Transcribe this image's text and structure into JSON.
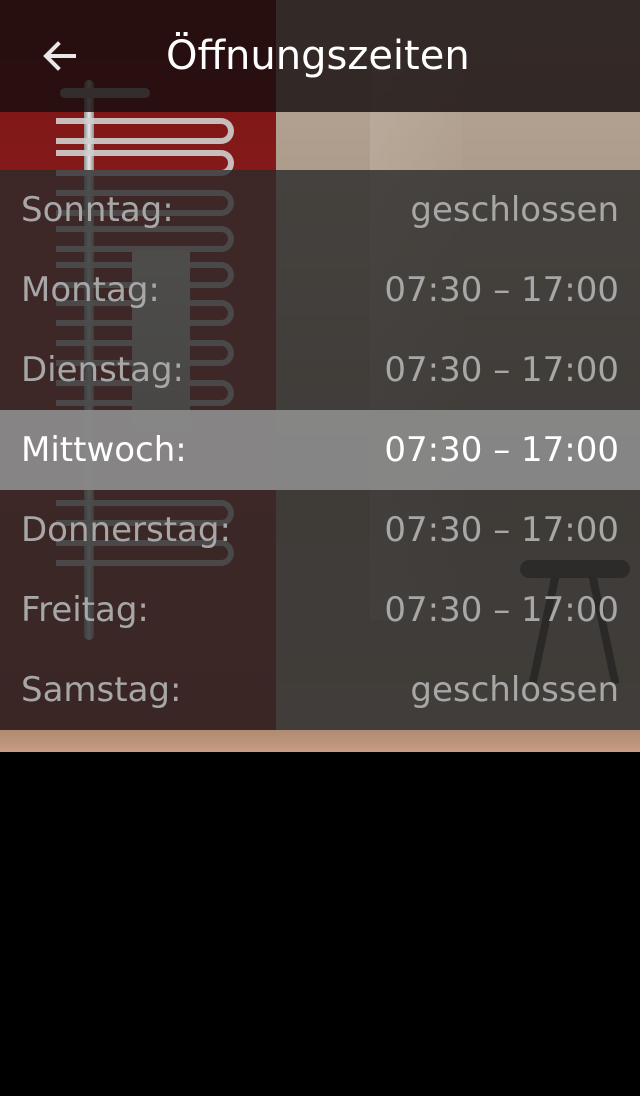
{
  "app_bar": {
    "title": "Öffnungszeiten",
    "back_icon": "arrow-left-icon"
  },
  "hours": [
    {
      "day": "Sonntag:",
      "time": "geschlossen",
      "highlighted": false
    },
    {
      "day": "Montag:",
      "time": "07:30 – 17:00",
      "highlighted": false
    },
    {
      "day": "Dienstag:",
      "time": "07:30 – 17:00",
      "highlighted": false
    },
    {
      "day": "Mittwoch:",
      "time": "07:30 – 17:00",
      "highlighted": true
    },
    {
      "day": "Donnerstag:",
      "time": "07:30 – 17:00",
      "highlighted": false
    },
    {
      "day": "Freitag:",
      "time": "07:30 – 17:00",
      "highlighted": false
    },
    {
      "day": "Samstag:",
      "time": "geschlossen",
      "highlighted": false
    }
  ],
  "colors": {
    "app_bar_bg": "#160e0e",
    "row_text": "#a7a7a7",
    "highlight_bg": "#8c8c8c",
    "highlight_text": "#ffffff",
    "screen_bg": "#000000"
  }
}
